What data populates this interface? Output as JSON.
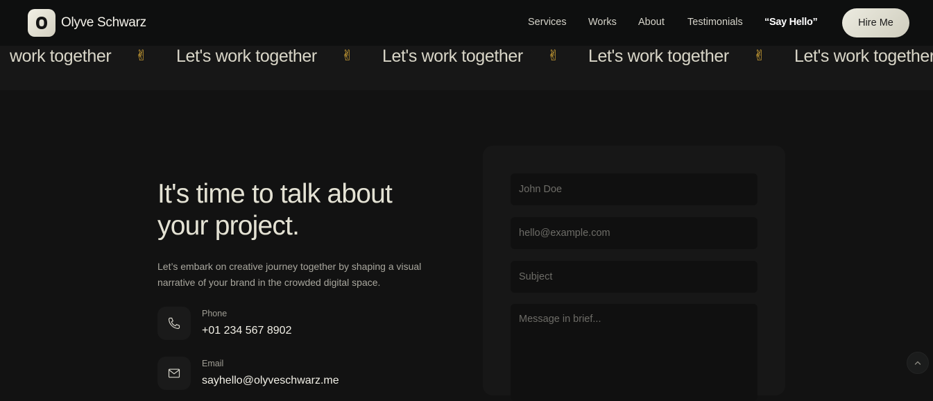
{
  "header": {
    "brand_name": "Olyve Schwarz",
    "nav": [
      "Services",
      "Works",
      "About",
      "Testimonials",
      "“Say Hello”"
    ],
    "cta_label": "Hire Me"
  },
  "marquee": {
    "text": "Let's work together",
    "emoji": "✌",
    "items": [
      "work together",
      "Let's work together",
      "Let's work together",
      "Let's work together",
      "Let's work together"
    ]
  },
  "contact_section": {
    "heading_line1": "It's time to talk about",
    "heading_line2": "your project.",
    "description": "Let’s embark on creative journey together by shaping a visual narrative of your brand in the crowded digital space.",
    "phone_label": "Phone",
    "phone_value": "+01 234 567 8902",
    "email_label": "Email",
    "email_value": "sayhello@olyveschwarz.me"
  },
  "form": {
    "name_placeholder": "John Doe",
    "email_placeholder": "hello@example.com",
    "subject_placeholder": "Subject",
    "message_placeholder": "Message in brief..."
  },
  "icons": {
    "logo": "logo-icon",
    "phone": "phone-icon",
    "email": "mail-icon",
    "scroll_top": "chevron-up-icon"
  },
  "colors": {
    "background": "#121212",
    "accent": "#e4e2d4",
    "emoji": "#e9b53a"
  }
}
